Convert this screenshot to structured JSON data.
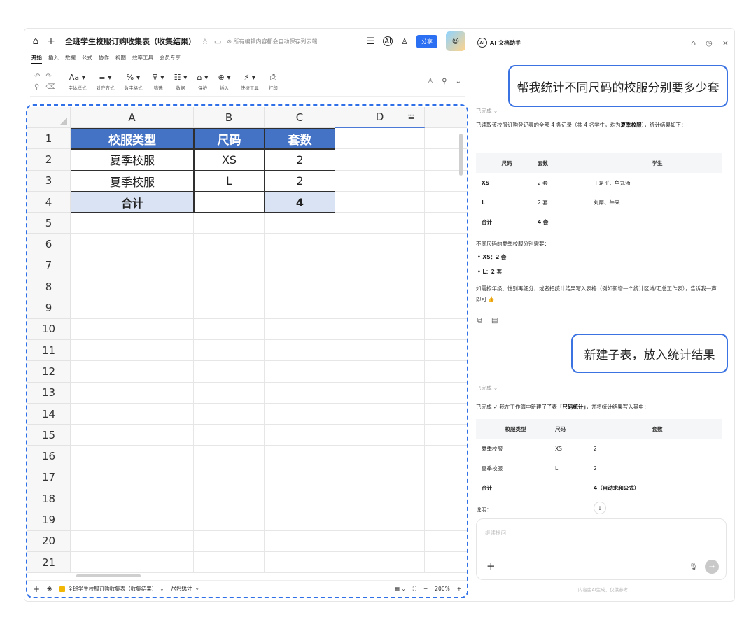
{
  "titlebar": {
    "home_icon": "home-icon",
    "new_icon": "plus-icon",
    "doc_title": "全班学生校服订购收集表（收集结果）",
    "save_note": "所有编辑内容都会自动保存到云端",
    "share_label": "分享"
  },
  "menus": [
    "开始",
    "插入",
    "数据",
    "公式",
    "协作",
    "视图",
    "效率工具",
    "会员专享"
  ],
  "ribbon": {
    "items": [
      {
        "glyph": "Aa ▾",
        "label": "字体样式"
      },
      {
        "glyph": "≡ ▾",
        "label": "对齐方式"
      },
      {
        "glyph": "% ▾",
        "label": "数字格式"
      },
      {
        "glyph": "⊽ ▾",
        "label": "筛选"
      },
      {
        "glyph": "☷ ▾",
        "label": "数据"
      },
      {
        "glyph": "⌂ ▾",
        "label": "保护"
      },
      {
        "glyph": "⊕ ▾",
        "label": "插入"
      },
      {
        "glyph": "⚡ ▾",
        "label": "快捷工具"
      },
      {
        "glyph": "⎙",
        "label": "打印"
      }
    ]
  },
  "sheet": {
    "col_headers": [
      "A",
      "B",
      "C",
      "D"
    ],
    "rows": [
      {
        "n": "1",
        "a": "校服类型",
        "b": "尺码",
        "c": "套数"
      },
      {
        "n": "2",
        "a": "夏季校服",
        "b": "XS",
        "c": "2"
      },
      {
        "n": "3",
        "a": "夏季校服",
        "b": "L",
        "c": "2"
      },
      {
        "n": "4",
        "a": "合计",
        "b": "",
        "c": "4"
      },
      {
        "n": "5"
      },
      {
        "n": "6"
      },
      {
        "n": "7"
      },
      {
        "n": "8"
      },
      {
        "n": "9"
      },
      {
        "n": "10"
      },
      {
        "n": "11"
      },
      {
        "n": "12"
      },
      {
        "n": "13"
      },
      {
        "n": "14"
      },
      {
        "n": "15"
      },
      {
        "n": "16"
      },
      {
        "n": "17"
      },
      {
        "n": "18"
      },
      {
        "n": "19"
      },
      {
        "n": "20"
      },
      {
        "n": "21"
      }
    ],
    "tabs": [
      {
        "label": "全班学生校服订购收集表（收集结果）",
        "current": false
      },
      {
        "label": "尺码统计",
        "current": true
      }
    ],
    "zoom": "200%"
  },
  "ai": {
    "title": "AI 文档助手",
    "user_msg_1": "帮我统计不同尺码的校服分别要多少套",
    "status_1": "已完成",
    "intro_1_pre": "已读取该校服订购登记表的全部 4 条记录（共 4 名学生，均为",
    "intro_1_bold": "夏季校服",
    "intro_1_post": "），统计结果如下：",
    "table1": {
      "headers": [
        "尺码",
        "套数",
        "学生"
      ],
      "rows": [
        [
          "XS",
          "2 套",
          "于是乎、鱼丸汤"
        ],
        [
          "L",
          "2 套",
          "刘犀、牛来"
        ],
        [
          "合计",
          "4 套",
          ""
        ]
      ]
    },
    "summary_line": "不同尺码的夏季校服分别需要：",
    "bullets": [
      "XS：2 套",
      "L：2 套"
    ],
    "followup": "如需按年级、性别再细分，或者把统计结果写入表格（例如新增一个统计区域/汇总工作表），告诉我一声即可 👍",
    "user_msg_2": "新建子表，放入统计结果",
    "status_2": "已完成",
    "intro_2_pre": "已完成 ✓ 我在工作簿中新建了子表",
    "intro_2_bold": "「尺码统计」",
    "intro_2_post": "，并将统计结果写入其中：",
    "table2": {
      "headers": [
        "校服类型",
        "尺码",
        "套数"
      ],
      "rows": [
        [
          "夏季校服",
          "XS",
          "2"
        ],
        [
          "夏季校服",
          "L",
          "2"
        ],
        [
          "合计",
          "",
          "4（自动求和公式）"
        ]
      ]
    },
    "note_label": "说明：",
    "input_placeholder": "继续提问",
    "footnote": "内容由AI生成，仅供参考"
  }
}
